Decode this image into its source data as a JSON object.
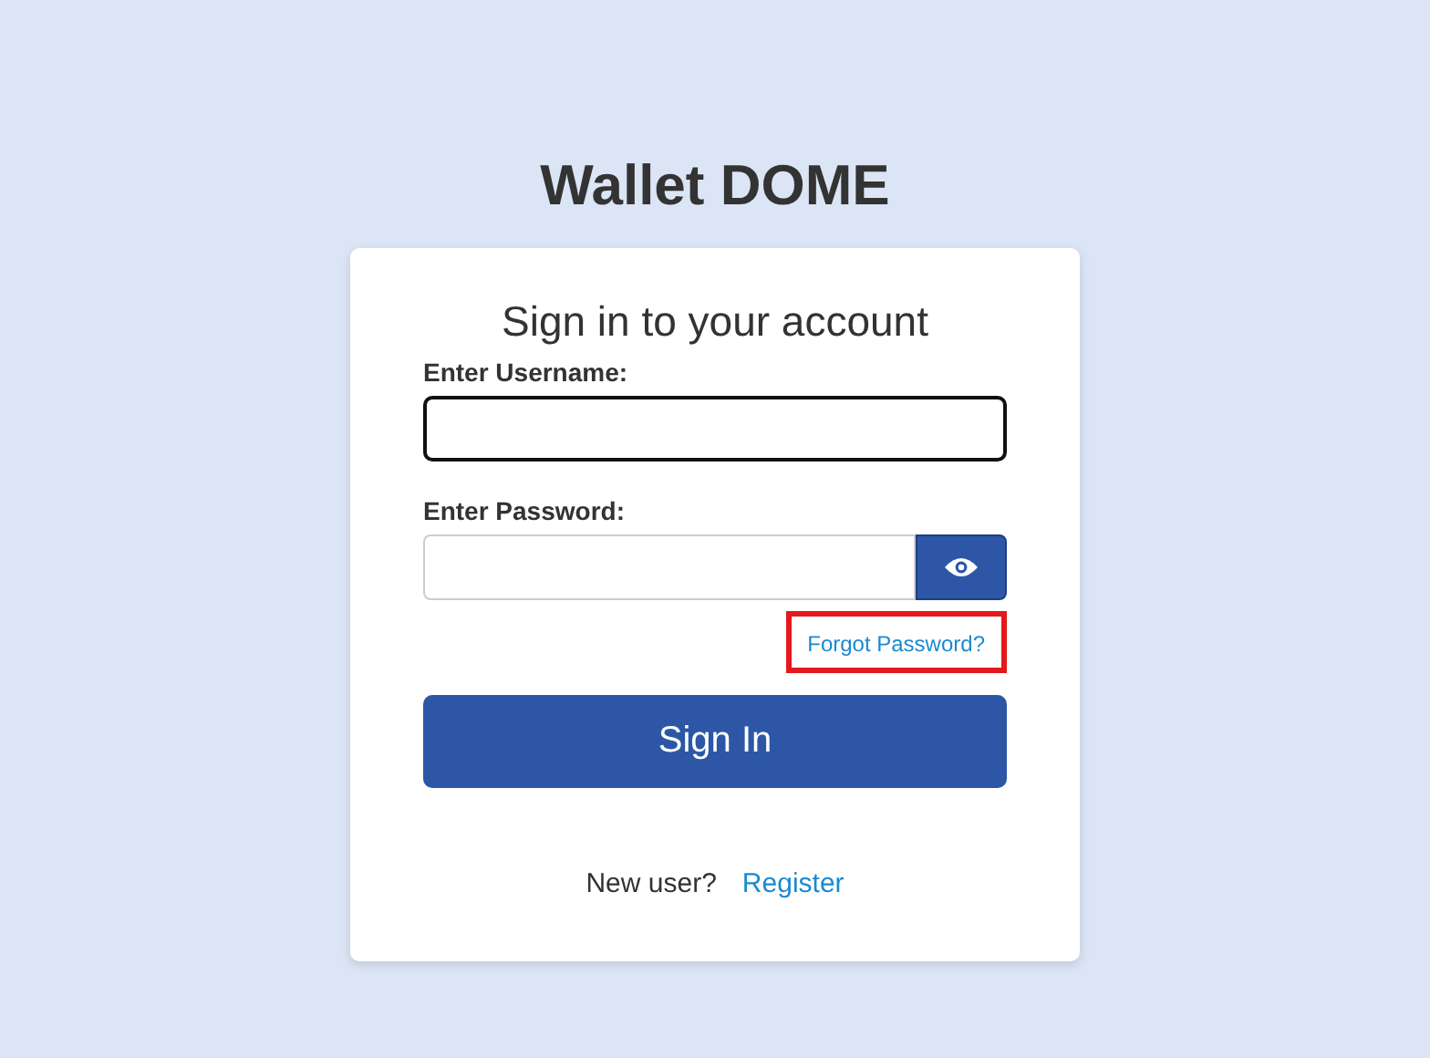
{
  "app_title": "Wallet DOME",
  "card": {
    "heading": "Sign in to your account",
    "username": {
      "label": "Enter Username:",
      "focused": true
    },
    "password": {
      "label": "Enter Password:",
      "focused": false
    },
    "forgot_link": {
      "text": "Forgot Password?",
      "highlighted": true
    },
    "submit_button": "Sign In",
    "register_prompt": {
      "text": "New user?",
      "link": "Register"
    }
  }
}
